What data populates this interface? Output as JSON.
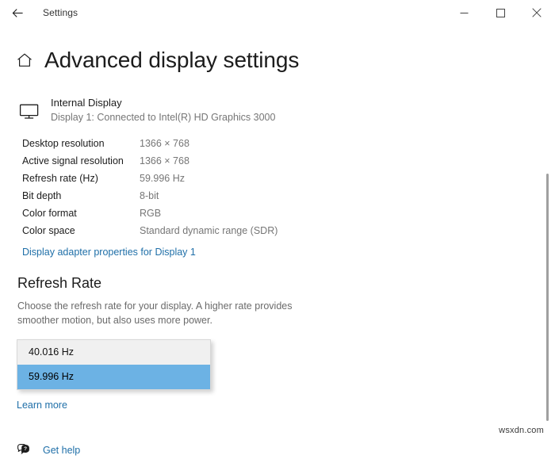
{
  "window": {
    "app_title": "Settings",
    "back_icon": "back-arrow-icon",
    "minimize_label": "—",
    "maximize_label": "□",
    "close_label": "×"
  },
  "page": {
    "home_icon": "home-icon",
    "title": "Advanced display settings"
  },
  "display": {
    "monitor_icon": "monitor-icon",
    "name": "Internal Display",
    "subtitle": "Display 1: Connected to Intel(R) HD Graphics 3000"
  },
  "specs": [
    {
      "label": "Desktop resolution",
      "value": "1366 × 768"
    },
    {
      "label": "Active signal resolution",
      "value": "1366 × 768"
    },
    {
      "label": "Refresh rate (Hz)",
      "value": "59.996 Hz"
    },
    {
      "label": "Bit depth",
      "value": "8-bit"
    },
    {
      "label": "Color format",
      "value": "RGB"
    },
    {
      "label": "Color space",
      "value": "Standard dynamic range (SDR)"
    }
  ],
  "adapter_link": "Display adapter properties for Display 1",
  "refresh_rate": {
    "heading": "Refresh Rate",
    "description": "Choose the refresh rate for your display. A higher rate provides smoother motion, but also uses more power.",
    "options": [
      {
        "label": "40.016 Hz",
        "selected": false
      },
      {
        "label": "59.996 Hz",
        "selected": true
      }
    ],
    "selected_value": "59.996 Hz",
    "learn_more": "Learn more"
  },
  "footer": {
    "help_icon": "help-bubble-icon",
    "help_label": "Get help"
  },
  "watermark": "wsxdn.com",
  "colors": {
    "link": "#1f6fa8",
    "selection": "#6cb2e4",
    "dropdown_bg": "#f0f0f0",
    "secondary_text": "#767676"
  }
}
